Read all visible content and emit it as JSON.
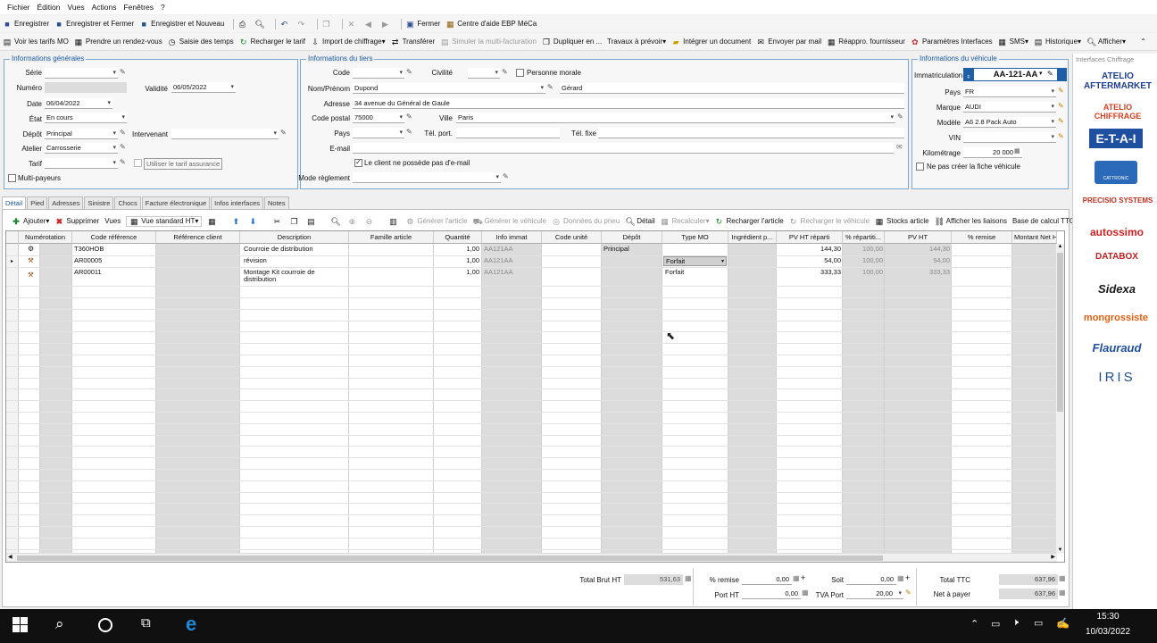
{
  "menu": [
    "Fichier",
    "Édition",
    "Vues",
    "Actions",
    "Fenêtres",
    "?"
  ],
  "toolbar1": {
    "save": "Enregistrer",
    "save_close": "Enregistrer et Fermer",
    "save_new": "Enregistrer et Nouveau",
    "close": "Fermer",
    "help": "Centre d'aide EBP MéCa"
  },
  "toolbar2": [
    "Voir les tarifs MO",
    "Prendre un rendez-vous",
    "Saisie des temps",
    "Recharger le tarif",
    "Import de chiffrage",
    "Transférer",
    "Simuler la multi-facturation",
    "Dupliquer en ...",
    "Travaux à prévoir",
    "Intégrer un document",
    "Envoyer par mail",
    "Réappro. fournisseur",
    "Paramètres Interfaces",
    "SMS",
    "Historique",
    "Afficher"
  ],
  "general": {
    "title": "Informations générales",
    "serie_label": "Série",
    "numero_label": "Numéro",
    "validite_label": "Validité",
    "validite": "06/05/2022",
    "date_label": "Date",
    "date": "06/04/2022",
    "etat_label": "État",
    "etat": "En cours",
    "depot_label": "Dépôt",
    "depot": "Principal",
    "intervenant_label": "Intervenant",
    "atelier_label": "Atelier",
    "atelier": "Carrosserie",
    "tarif_label": "Tarif",
    "tarif_assurance": "Utiliser le tarif assurance",
    "multi_payeurs": "Multi-payeurs"
  },
  "tiers": {
    "title": "Informations du tiers",
    "code_label": "Code",
    "civilite_label": "Civilité",
    "personne_morale": "Personne morale",
    "nom_label": "Nom/Prénom",
    "nom": "Dupond",
    "prenom": "Gérard",
    "adresse_label": "Adresse",
    "adresse": "34 avenue du Général de Gaule",
    "cp_label": "Code postal",
    "cp": "75000",
    "ville_label": "Ville",
    "ville": "Paris",
    "pays_label": "Pays",
    "tel_port_label": "Tél. port.",
    "tel_fixe_label": "Tél. fixe",
    "email_label": "E-mail",
    "no_email": "Le client ne possède pas d'e-mail",
    "reglement_label": "Mode règlement"
  },
  "vehicule": {
    "title": "Informations du véhicule",
    "immat_label": "Immatriculation",
    "immat": "AA-121-AA",
    "pays_label": "Pays",
    "pays": "FR",
    "marque_label": "Marque",
    "marque": "AUDI",
    "modele_label": "Modèle",
    "modele": "A6 2.8 Pack Auto",
    "vin_label": "VIN",
    "km_label": "Kilométrage",
    "km": "20 000",
    "no_fiche": "Ne pas créer la fiche véhicule"
  },
  "tabs": [
    "Détail",
    "Pied",
    "Adresses",
    "Sinistre",
    "Chocs",
    "Facture électronique",
    "Infos interfaces",
    "Notes"
  ],
  "gridbar": [
    "Ajouter",
    "Supprimer",
    "Vues",
    "Vue standard HT",
    "Générer l'article",
    "Générer le véhicule",
    "Données du pneu",
    "Détail",
    "Recalculer",
    "Recharger l'article",
    "Recharger le véhicule",
    "Stocks article",
    "Afficher les liaisons",
    "Base de calcul TTC"
  ],
  "columns": [
    "Numérotation",
    "Code référence",
    "Référence client",
    "Description",
    "Famille article",
    "Quantité",
    "Info immat",
    "Code unité",
    "Dépôt",
    "Type MO",
    "Ingrédient p...",
    "PV HT réparti",
    "% répartiti...",
    "PV HT",
    "% remise",
    "Montant Net HT r"
  ],
  "rows": [
    {
      "code": "T360HOB",
      "desc": "Courroie de distribution",
      "desc2": "",
      "qty": "1,00",
      "immat": "AA121AA",
      "depot": "Principal",
      "type": "",
      "pvr": "144,30",
      "pct": "100,00",
      "pv": "144,30"
    },
    {
      "code": "AR00005",
      "desc": "révision",
      "desc2": "",
      "qty": "1,00",
      "immat": "AA121AA",
      "depot": "",
      "type": "Forfait",
      "pvr": "54,00",
      "pct": "100,00",
      "pv": "54,00"
    },
    {
      "code": "AR00011",
      "desc": "Montage Kit courroie de",
      "desc2": "distribution",
      "qty": "1,00",
      "immat": "AA121AA",
      "depot": "",
      "type": "Forfait",
      "pvr": "333,33",
      "pct": "100,00",
      "pv": "333,33"
    }
  ],
  "totals": {
    "brut_label": "Total Brut HT",
    "brut": "531,63",
    "remise_label": "% remise",
    "remise": "0,00",
    "soit_label": "Soit",
    "soit": "0,00",
    "ttc_label": "Total TTC",
    "ttc": "637,96",
    "port_label": "Port HT",
    "port": "0,00",
    "tva_label": "TVA Port",
    "tva": "20,00",
    "net_label": "Net à payer",
    "net": "637,96"
  },
  "side": {
    "title": "Interfaces Chiffrage",
    "logos": [
      "ATELIO AFTERMARKET",
      "ATELIO CHIFFRAGE",
      "E-T-A-I",
      "CATTRONIC",
      "PRECISIO SYSTEMS",
      "autossimo",
      "DATABOX",
      "Sidexa",
      "mongrossiste",
      "Flauraud",
      "IRIS"
    ]
  },
  "taskbar": {
    "time": "15:30",
    "date": "10/03/2022"
  }
}
